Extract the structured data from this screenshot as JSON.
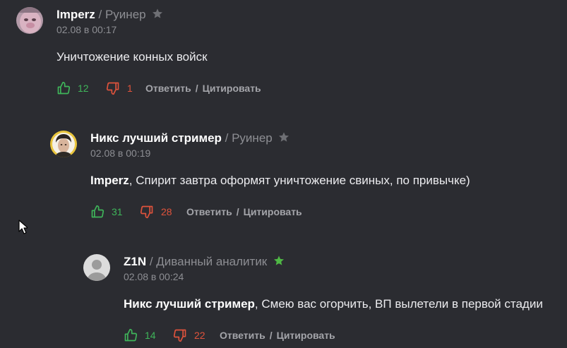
{
  "comments": [
    {
      "username": "Imperz",
      "role_sep": " / ",
      "role": "Руинер",
      "star_color": "#6e6f74",
      "date": "02.08 в 00:17",
      "mention": "",
      "text": "Уничтожение конных войск",
      "likes": "12",
      "dislikes": "1",
      "reply_label": "Ответить",
      "action_sep": "/",
      "quote_label": "Цитировать"
    },
    {
      "username": "Никс лучший стример",
      "role_sep": " / ",
      "role": "Руинер",
      "star_color": "#6e6f74",
      "date": "02.08 в 00:19",
      "mention": "Imperz",
      "text": ", Спирит завтра оформят уничтожение свиных, по привычке)",
      "likes": "31",
      "dislikes": "28",
      "reply_label": "Ответить",
      "action_sep": "/",
      "quote_label": "Цитировать"
    },
    {
      "username": "Z1N",
      "role_sep": " / ",
      "role": "Диванный аналитик",
      "star_color": "#4fb845",
      "date": "02.08 в 00:24",
      "mention": "Никс лучший стример",
      "text": ", Смею вас огорчить, ВП вылетели в первой стадии",
      "likes": "14",
      "dislikes": "22",
      "reply_label": "Ответить",
      "action_sep": "/",
      "quote_label": "Цитировать"
    }
  ],
  "colors": {
    "background": "#2b2c31",
    "like": "#3fb55a",
    "dislike": "#e0533c",
    "muted": "#8d8e93"
  }
}
